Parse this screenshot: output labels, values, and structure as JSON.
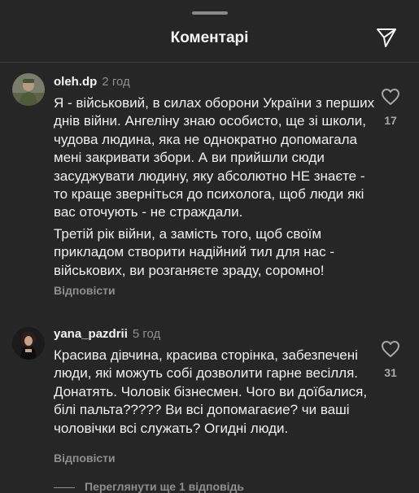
{
  "sheet": {
    "title": "Коментарі",
    "send_icon": "send-icon"
  },
  "comments": [
    {
      "author": "oleh.dp",
      "time": "2 год",
      "paragraphs": [
        "Я - військовий, в силах оборони України з перших днів війни. Ангеліну знаю особисто, ще зі школи, чудова людина, яка не однократно допомагала мені закривати збори. А ви прийшли сюди засуджувати людину, яку абсолютно НЕ знаєте - то краще зверніться до психолога, щоб люди які вас оточують - не страждали.",
        "Третій рік війни, а замість того, щоб своїм прикладом створити надійний тил для нас - військових, ви розганяєте зраду, соромно!"
      ],
      "likes": "17",
      "reply_label": "Відповісти"
    },
    {
      "author": "yana_pazdrii",
      "time": "5 год",
      "paragraphs": [
        "Красива дівчина, красива сторінка, забезпечені люди, які можуть собі дозволити гарне весілля. Донатять. Чоловік бізнесмен. Чого ви доїбалися, білі пальта????? Ви всі допомагаєие? чи ваші чоловічки всі служать? Огидні люди."
      ],
      "likes": "31",
      "reply_label": "Відповісти",
      "view_replies": "Переглянути ще 1 відповідь"
    }
  ],
  "colors": {
    "background": "#262626",
    "text": "#f5f5f5",
    "secondary": "#8e8e8e"
  }
}
